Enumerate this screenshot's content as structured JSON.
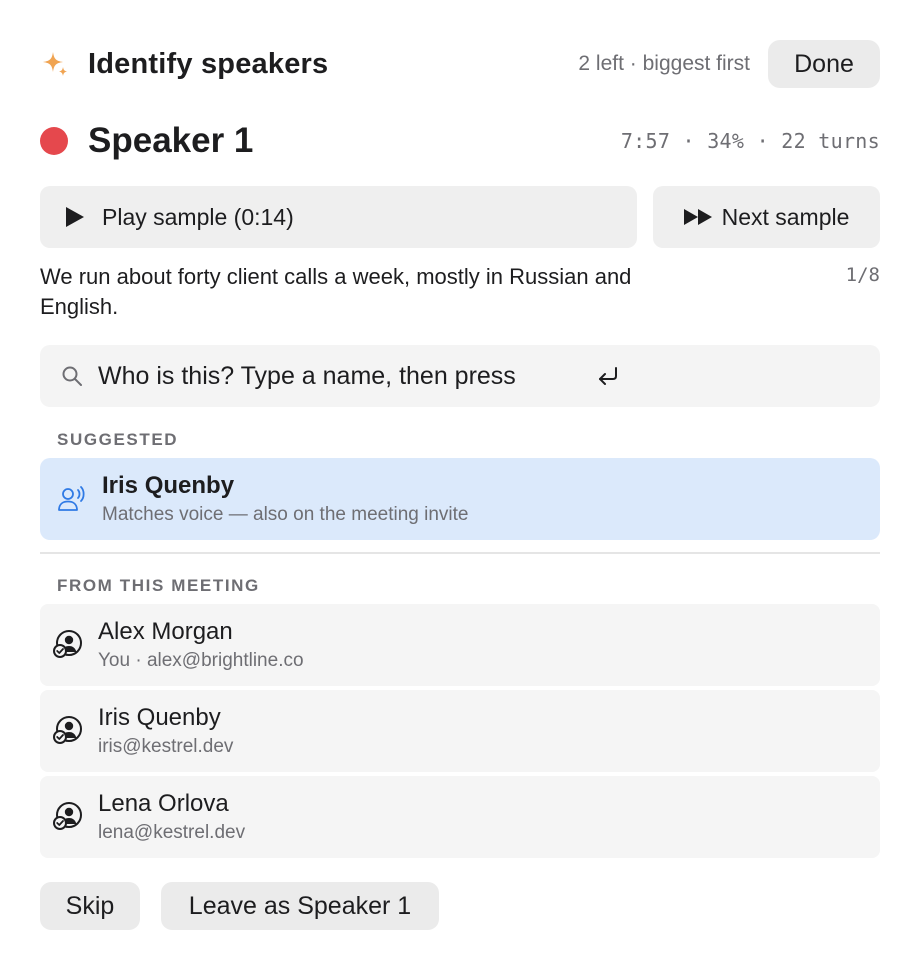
{
  "header": {
    "icon": "sparkle-icon",
    "title": "Identify speakers",
    "progress": "2 left · biggest first",
    "done_label": "Done"
  },
  "speaker": {
    "name": "Speaker 1",
    "color": "#e5484d",
    "stats": "7:57 · 34% · 22 turns"
  },
  "sample": {
    "play_label": "Play sample (0:14)",
    "next_label": "Next sample",
    "transcript": "We run about forty client calls a week, mostly in Russian and English.",
    "counter": "1/8"
  },
  "search": {
    "placeholder": "Who is this? Type a name, then press",
    "icon": "search-icon",
    "return_icon": "return-key-icon"
  },
  "suggested": {
    "heading": "SUGGESTED",
    "icon": "voice-match-icon",
    "highlight_color": "#dbe9fb",
    "name": "Iris Quenby",
    "detail": "Matches voice — also on the meeting invite"
  },
  "meeting": {
    "heading": "FROM THIS MEETING",
    "icon": "person-check-icon",
    "people": [
      {
        "name": "Alex Morgan",
        "detail": "You · alex@brightline.co"
      },
      {
        "name": "Iris Quenby",
        "detail": "iris@kestrel.dev"
      },
      {
        "name": "Lena Orlova",
        "detail": "lena@kestrel.dev"
      }
    ]
  },
  "footer": {
    "skip_label": "Skip",
    "leave_label": "Leave as Speaker 1"
  }
}
